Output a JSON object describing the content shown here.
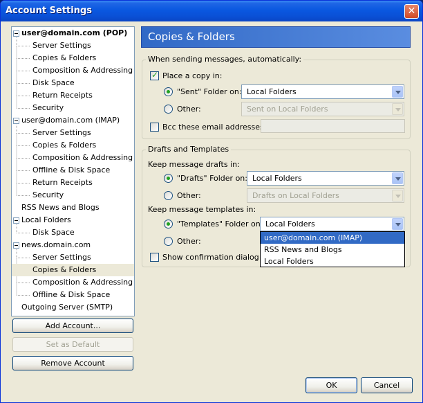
{
  "window": {
    "title": "Account Settings"
  },
  "tree": {
    "items": [
      {
        "label": "user@domain.com  (POP)",
        "level": 0,
        "bold": true
      },
      {
        "label": "Server Settings",
        "level": 1
      },
      {
        "label": "Copies & Folders",
        "level": 1
      },
      {
        "label": "Composition & Addressing",
        "level": 1
      },
      {
        "label": "Disk Space",
        "level": 1
      },
      {
        "label": "Return Receipts",
        "level": 1
      },
      {
        "label": "Security",
        "level": 1
      },
      {
        "label": "user@domain.com  (IMAP)",
        "level": 0
      },
      {
        "label": "Server Settings",
        "level": 1
      },
      {
        "label": "Copies & Folders",
        "level": 1
      },
      {
        "label": "Composition & Addressing",
        "level": 1
      },
      {
        "label": "Offline & Disk Space",
        "level": 1
      },
      {
        "label": "Return Receipts",
        "level": 1
      },
      {
        "label": "Security",
        "level": 1
      },
      {
        "label": "RSS News and Blogs",
        "level": 0
      },
      {
        "label": "Local Folders",
        "level": 0
      },
      {
        "label": "Disk Space",
        "level": 1
      },
      {
        "label": "news.domain.com",
        "level": 0
      },
      {
        "label": "Server Settings",
        "level": 1
      },
      {
        "label": "Copies & Folders",
        "level": 1,
        "selected": true
      },
      {
        "label": "Composition & Addressing",
        "level": 1
      },
      {
        "label": "Offline & Disk Space",
        "level": 1
      },
      {
        "label": "Outgoing Server (SMTP)",
        "level": 0
      }
    ]
  },
  "left_buttons": {
    "add_account": "Add Account...",
    "set_default": "Set as Default",
    "remove_account": "Remove Account"
  },
  "panel": {
    "title": "Copies & Folders",
    "sending": {
      "group_label": "When sending messages, automatically:",
      "place_copy_label": "Place a copy in:",
      "place_copy_checked": true,
      "sent_folder_label": "\"Sent\" Folder on:",
      "sent_folder_value": "Local Folders",
      "other_label": "Other:",
      "other_value": "Sent on Local Folders",
      "bcc_label": "Bcc these email addresses:",
      "bcc_checked": false,
      "bcc_value": ""
    },
    "drafts": {
      "group_label": "Drafts and Templates",
      "keep_drafts_label": "Keep message drafts in:",
      "drafts_folder_label": "\"Drafts\" Folder on:",
      "drafts_folder_value": "Local Folders",
      "drafts_other_label": "Other:",
      "drafts_other_value": "Drafts on Local Folders",
      "keep_templates_label": "Keep message templates in:",
      "templates_folder_label": "\"Templates\" Folder on:",
      "templates_folder_value": "Local Folders",
      "templates_other_label": "Other:",
      "confirm_label": "Show confirmation dialog whe",
      "confirm_checked": false
    },
    "dropdown_options": [
      "user@domain.com  (IMAP)",
      "RSS News and Blogs",
      "Local Folders"
    ]
  },
  "footer": {
    "ok": "OK",
    "cancel": "Cancel"
  },
  "colors": {
    "selection": "#316ac5",
    "check_green": "#21a121",
    "header_blue": "#3169c6"
  }
}
